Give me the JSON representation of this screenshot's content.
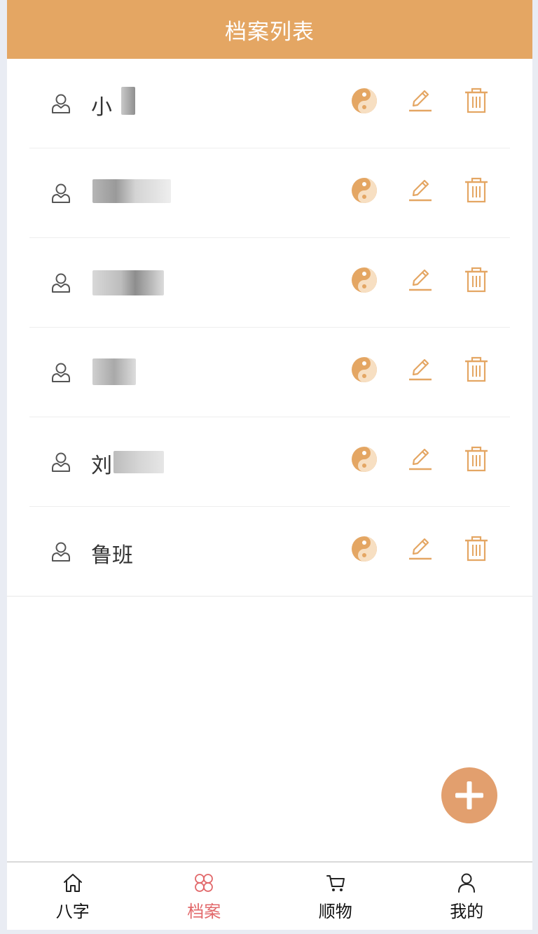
{
  "header": {
    "title": "档案列表"
  },
  "colors": {
    "header_bg": "#e4a663",
    "action_icon": "#e4a663",
    "fab_bg": "#e29f6e",
    "tab_active": "#e2696b"
  },
  "records": [
    {
      "name": "小"
    },
    {
      "name": ""
    },
    {
      "name": ""
    },
    {
      "name": ""
    },
    {
      "name": "刘"
    },
    {
      "name": "鲁班"
    }
  ],
  "actions": {
    "bazi_icon": "yin-yang-icon",
    "edit_icon": "pencil-icon",
    "delete_icon": "trash-icon"
  },
  "fab": {
    "icon": "plus-icon"
  },
  "tabbar": {
    "tabs": [
      {
        "label": "八字",
        "icon": "home-icon"
      },
      {
        "label": "档案",
        "icon": "clover-icon",
        "active": true
      },
      {
        "label": "顺物",
        "icon": "cart-icon"
      },
      {
        "label": "我的",
        "icon": "user-icon"
      }
    ]
  }
}
